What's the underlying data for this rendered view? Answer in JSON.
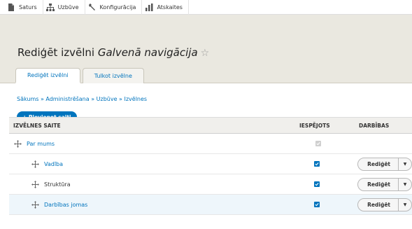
{
  "toolbar": {
    "items": [
      {
        "label": "Saturs",
        "icon": "document-icon"
      },
      {
        "label": "Uzbūve",
        "icon": "sitemap-icon"
      },
      {
        "label": "Konfigurācija",
        "icon": "wrench-icon"
      },
      {
        "label": "Atskaites",
        "icon": "bar-chart-icon"
      }
    ]
  },
  "header": {
    "title_prefix": "Rediģēt izvēlni",
    "title_menu": "Galvenā navigācija",
    "star": "☆",
    "tabs": [
      {
        "label": "Rediģēt izvēlni",
        "active": true
      },
      {
        "label": "Tulkot izvēlne",
        "active": false
      }
    ]
  },
  "breadcrumb": "Sākums » Administrēšana » Uzbūve » Izvēlnes",
  "add_link_button": "+ Pievienot saiti",
  "table": {
    "headers": {
      "link": "IZVĒLNES SAITE",
      "enabled": "IESPĒJOTS",
      "operations": "DARBĪBAS"
    },
    "rows": [
      {
        "title": "Par mums",
        "level": 0,
        "enabled": true,
        "disabled_checkbox": true,
        "edit": ""
      },
      {
        "title": "Vadība",
        "level": 1,
        "enabled": true,
        "disabled_checkbox": false,
        "edit": "Rediģēt"
      },
      {
        "title": "Struktūra",
        "level": 1,
        "enabled": true,
        "disabled_checkbox": false,
        "edit": "Rediģēt"
      },
      {
        "title": "Darbības jomas",
        "level": 1,
        "enabled": true,
        "disabled_checkbox": false,
        "edit": "Rediģēt"
      }
    ]
  },
  "colors": {
    "accent": "#0074bd",
    "header_bg": "#eae8e0"
  }
}
